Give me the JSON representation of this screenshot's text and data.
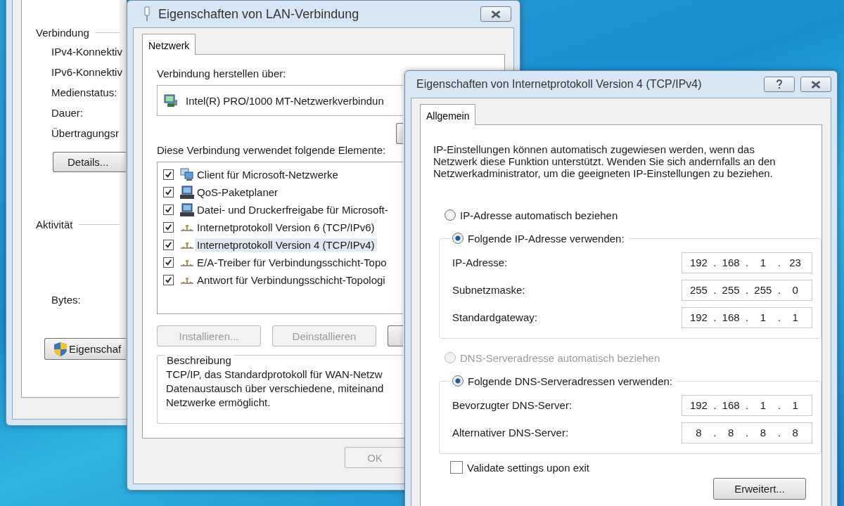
{
  "status_window": {
    "groups": [
      {
        "title": "Verbindung",
        "rows": [
          "IPv4-Konnektiv",
          "IPv6-Konnektiv",
          "Medienstatus:",
          "Dauer:",
          "Übertragungsr"
        ]
      }
    ],
    "details_button": "Details...",
    "activity_title": "Aktivität",
    "bytes_label": "Bytes:",
    "properties_button": "Eigenschaf"
  },
  "lan_window": {
    "title": "Eigenschaften von LAN-Verbindung",
    "tab": {
      "label": "Netzwerk",
      "selected": true
    },
    "connect_via_label": "Verbindung herstellen über:",
    "adapter": "Intel(R) PRO/1000 MT-Netzwerkverbindun",
    "elements_label": "Diese Verbindung verwendet folgende Elemente:",
    "elements": [
      {
        "label": "Client für Microsoft-Netzwerke",
        "checked": true,
        "selected": false,
        "kind": "client"
      },
      {
        "label": "QoS-Paketplaner",
        "checked": true,
        "selected": false,
        "kind": "service"
      },
      {
        "label": "Datei- und Druckerfreigabe für Microsoft-",
        "checked": true,
        "selected": false,
        "kind": "service"
      },
      {
        "label": "Internetprotokoll Version 6 (TCP/IPv6)",
        "checked": true,
        "selected": false,
        "kind": "protocol"
      },
      {
        "label": "Internetprotokoll Version 4 (TCP/IPv4)",
        "checked": true,
        "selected": true,
        "kind": "protocol"
      },
      {
        "label": "E/A-Treiber für Verbindungsschicht-Topo",
        "checked": true,
        "selected": false,
        "kind": "protocol"
      },
      {
        "label": "Antwort für Verbindungsschicht-Topologi",
        "checked": true,
        "selected": false,
        "kind": "protocol"
      }
    ],
    "buttons": [
      {
        "label": "Installieren...",
        "disabled": true
      },
      {
        "label": "Deinstallieren",
        "disabled": true
      }
    ],
    "description": {
      "title": "Beschreibung",
      "lines": [
        "TCP/IP, das Standardprotokoll für WAN-Netzw",
        "Datenaustausch über verschiedene, miteinand",
        "Netzwerke ermöglicht."
      ]
    },
    "ok_button": {
      "label": "OK",
      "disabled": true
    }
  },
  "ipv4_window": {
    "title": "Eigenschaften von Internetprotokoll Version 4 (TCP/IPv4)",
    "tab": {
      "label": "Allgemein",
      "selected": true
    },
    "intro": "IP-Einstellungen können automatisch zugewiesen werden, wenn das Netzwerk diese Funktion unterstützt. Wenden Sie sich andernfalls an den Netzwerkadministrator, um die geeigneten IP-Einstellungen zu beziehen.",
    "ip_mode": [
      {
        "label": "IP-Adresse automatisch beziehen",
        "selected": false,
        "disabled": false
      },
      {
        "label": "Folgende IP-Adresse verwenden:",
        "selected": true,
        "disabled": false
      }
    ],
    "ip_fields": [
      {
        "label": "IP-Adresse:",
        "octets": [
          "192",
          "168",
          "1",
          "23"
        ]
      },
      {
        "label": "Subnetzmaske:",
        "octets": [
          "255",
          "255",
          "255",
          "0"
        ]
      },
      {
        "label": "Standardgateway:",
        "octets": [
          "192",
          "168",
          "1",
          "1"
        ]
      }
    ],
    "dns_mode": [
      {
        "label": "DNS-Serveradresse automatisch beziehen",
        "selected": false,
        "disabled": true
      },
      {
        "label": "Folgende DNS-Serveradressen verwenden:",
        "selected": true,
        "disabled": false
      }
    ],
    "dns_fields": [
      {
        "label": "Bevorzugter DNS-Server:",
        "octets": [
          "192",
          "168",
          "1",
          "1"
        ]
      },
      {
        "label": "Alternativer DNS-Server:",
        "octets": [
          "8",
          "8",
          "8",
          "8"
        ]
      }
    ],
    "octet_separator": ".",
    "validate": {
      "label": "Validate settings upon exit",
      "checked": false
    },
    "advanced_button": "Erweitert..."
  }
}
